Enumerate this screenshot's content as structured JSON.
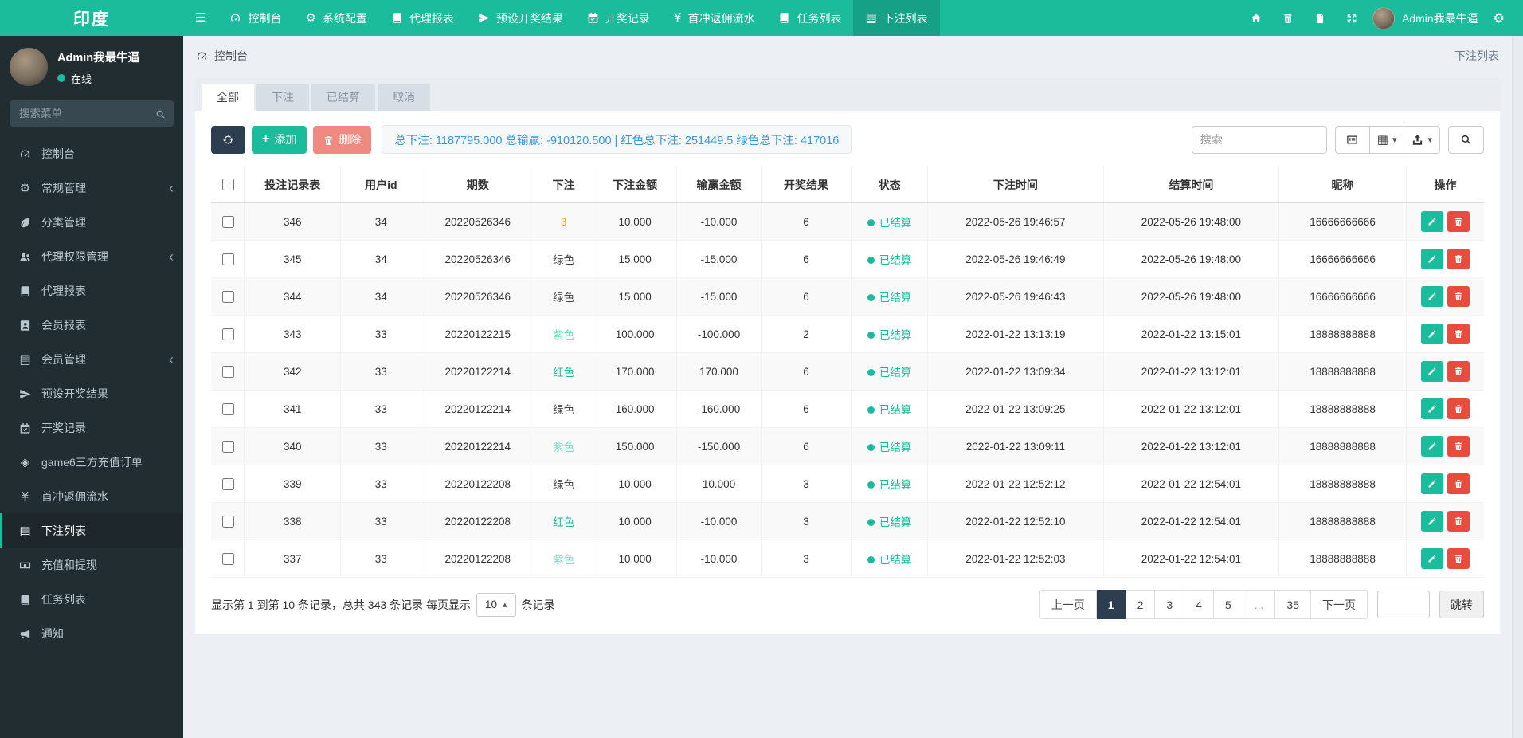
{
  "colors": {
    "navbar_teal": "#1abc9c",
    "navbar_active": "#16a085",
    "sidebar_dark": "#222d32",
    "navy": "#2c3e50",
    "add_green": "#1abc9c",
    "delete_salmon": "#ef8a80",
    "danger_red": "#e74c3c",
    "summary_blue": "#3498db",
    "status_green": "#18bc9c",
    "page_bg": "#ecf0f5"
  },
  "icon_glyphs": {
    "hamburger": "☰",
    "gear": "⚙",
    "gears": "⚙",
    "yen": "¥",
    "gem": "◈",
    "list": "▤",
    "grid": "▦",
    "caret-down": "▾",
    "caret-up": "▴",
    "chevron-left": "‹"
  },
  "navbar": {
    "brand": "印度",
    "items": [
      {
        "name": "sidebar-toggle",
        "icon": "hamburger",
        "label": ""
      },
      {
        "name": "dashboard",
        "icon": "speedo",
        "label": "控制台"
      },
      {
        "name": "system-config",
        "icon": "gear",
        "label": "系统配置"
      },
      {
        "name": "agent-report",
        "icon": "book",
        "label": "代理报表"
      },
      {
        "name": "preset-results",
        "icon": "send",
        "label": "预设开奖结果"
      },
      {
        "name": "draw-records",
        "icon": "calendar",
        "label": "开奖记录"
      },
      {
        "name": "first-charge-rebate",
        "icon": "yen",
        "label": "首冲返佣流水"
      },
      {
        "name": "task-list",
        "icon": "book",
        "label": "任务列表"
      },
      {
        "name": "bet-list",
        "icon": "list",
        "label": "下注列表",
        "active": true
      }
    ],
    "right_icons": [
      {
        "name": "home",
        "icon": "home"
      },
      {
        "name": "clear-trash",
        "icon": "trash"
      },
      {
        "name": "clear-cache",
        "icon": "doc"
      },
      {
        "name": "fullscreen",
        "icon": "expand"
      }
    ],
    "user": {
      "name": "Admin我最牛逼"
    }
  },
  "sidebar": {
    "user": {
      "name": "Admin我最牛逼",
      "status": "在线"
    },
    "search_placeholder": "搜索菜单",
    "items": [
      {
        "name": "dashboard",
        "icon": "speedo",
        "label": "控制台"
      },
      {
        "name": "general-management",
        "icon": "gears",
        "label": "常规管理",
        "arrow": true
      },
      {
        "name": "category-management",
        "icon": "leaf",
        "label": "分类管理"
      },
      {
        "name": "agent-permission",
        "icon": "users",
        "label": "代理权限管理",
        "arrow": true
      },
      {
        "name": "agent-report",
        "icon": "book",
        "label": "代理报表"
      },
      {
        "name": "member-report",
        "icon": "contact",
        "label": "会员报表"
      },
      {
        "name": "member-management",
        "icon": "list",
        "label": "会员管理",
        "arrow": true
      },
      {
        "name": "preset-results",
        "icon": "send",
        "label": "预设开奖结果"
      },
      {
        "name": "draw-records",
        "icon": "calendar",
        "label": "开奖记录"
      },
      {
        "name": "game6-recharge-orders",
        "icon": "gem",
        "label": "game6三方充值订单"
      },
      {
        "name": "first-charge-rebate",
        "icon": "yen",
        "label": "首冲返佣流水"
      },
      {
        "name": "bet-list",
        "icon": "list",
        "label": "下注列表",
        "active": true
      },
      {
        "name": "recharge-withdraw",
        "icon": "money",
        "label": "充值和提现"
      },
      {
        "name": "task-list",
        "icon": "book",
        "label": "任务列表"
      },
      {
        "name": "notification",
        "icon": "horn",
        "label": "通知"
      }
    ]
  },
  "breadcrumb": {
    "left": "控制台",
    "right": "下注列表"
  },
  "tabs": [
    {
      "name": "all",
      "label": "全部",
      "active": true
    },
    {
      "name": "bet",
      "label": "下注"
    },
    {
      "name": "settled",
      "label": "已结算"
    },
    {
      "name": "cancel",
      "label": "取消"
    }
  ],
  "toolbar": {
    "add_label": "添加",
    "delete_label": "删除",
    "summary": "总下注: 1187795.000 总输赢: -910120.500 | 红色总下注: 251449.5 绿色总下注: 417016",
    "search_placeholder": "搜索"
  },
  "table": {
    "headers": [
      "投注记录表",
      "用户id",
      "期数",
      "下注",
      "下注金额",
      "输赢金额",
      "开奖结果",
      "状态",
      "下注时间",
      "结算时间",
      "昵称",
      "操作"
    ],
    "rows": [
      {
        "record_id": "346",
        "user_id": "34",
        "period": "20220526346",
        "bet": "3",
        "bet_color": "#f39c12",
        "bet_amount": "10.000",
        "win_loss": "-10.000",
        "result": "6",
        "status": "已结算",
        "bet_time": "2022-05-26 19:46:57",
        "settle_time": "2022-05-26 19:48:00",
        "nickname": "16666666666"
      },
      {
        "record_id": "345",
        "user_id": "34",
        "period": "20220526346",
        "bet": "绿色",
        "bet_color": "#454545",
        "bet_amount": "15.000",
        "win_loss": "-15.000",
        "result": "6",
        "status": "已结算",
        "bet_time": "2022-05-26 19:46:49",
        "settle_time": "2022-05-26 19:48:00",
        "nickname": "16666666666"
      },
      {
        "record_id": "344",
        "user_id": "34",
        "period": "20220526346",
        "bet": "绿色",
        "bet_color": "#454545",
        "bet_amount": "15.000",
        "win_loss": "-15.000",
        "result": "6",
        "status": "已结算",
        "bet_time": "2022-05-26 19:46:43",
        "settle_time": "2022-05-26 19:48:00",
        "nickname": "16666666666"
      },
      {
        "record_id": "343",
        "user_id": "33",
        "period": "20220122215",
        "bet": "紫色",
        "bet_color": "#79dcc4",
        "bet_amount": "100.000",
        "win_loss": "-100.000",
        "result": "2",
        "status": "已结算",
        "bet_time": "2022-01-22 13:13:19",
        "settle_time": "2022-01-22 13:15:01",
        "nickname": "18888888888"
      },
      {
        "record_id": "342",
        "user_id": "33",
        "period": "20220122214",
        "bet": "红色",
        "bet_color": "#18bc9c",
        "bet_amount": "170.000",
        "win_loss": "170.000",
        "result": "6",
        "status": "已结算",
        "bet_time": "2022-01-22 13:09:34",
        "settle_time": "2022-01-22 13:12:01",
        "nickname": "18888888888"
      },
      {
        "record_id": "341",
        "user_id": "33",
        "period": "20220122214",
        "bet": "绿色",
        "bet_color": "#454545",
        "bet_amount": "160.000",
        "win_loss": "-160.000",
        "result": "6",
        "status": "已结算",
        "bet_time": "2022-01-22 13:09:25",
        "settle_time": "2022-01-22 13:12:01",
        "nickname": "18888888888"
      },
      {
        "record_id": "340",
        "user_id": "33",
        "period": "20220122214",
        "bet": "紫色",
        "bet_color": "#79dcc4",
        "bet_amount": "150.000",
        "win_loss": "-150.000",
        "result": "6",
        "status": "已结算",
        "bet_time": "2022-01-22 13:09:11",
        "settle_time": "2022-01-22 13:12:01",
        "nickname": "18888888888"
      },
      {
        "record_id": "339",
        "user_id": "33",
        "period": "20220122208",
        "bet": "绿色",
        "bet_color": "#454545",
        "bet_amount": "10.000",
        "win_loss": "10.000",
        "result": "3",
        "status": "已结算",
        "bet_time": "2022-01-22 12:52:12",
        "settle_time": "2022-01-22 12:54:01",
        "nickname": "18888888888"
      },
      {
        "record_id": "338",
        "user_id": "33",
        "period": "20220122208",
        "bet": "红色",
        "bet_color": "#18bc9c",
        "bet_amount": "10.000",
        "win_loss": "-10.000",
        "result": "3",
        "status": "已结算",
        "bet_time": "2022-01-22 12:52:10",
        "settle_time": "2022-01-22 12:54:01",
        "nickname": "18888888888"
      },
      {
        "record_id": "337",
        "user_id": "33",
        "period": "20220122208",
        "bet": "紫色",
        "bet_color": "#79dcc4",
        "bet_amount": "10.000",
        "win_loss": "-10.000",
        "result": "3",
        "status": "已结算",
        "bet_time": "2022-01-22 12:52:03",
        "settle_time": "2022-01-22 12:54:01",
        "nickname": "18888888888"
      }
    ]
  },
  "footer": {
    "showing": "显示第 1 到第 10 条记录，总共 343 条记录 每页显示",
    "page_size": "10",
    "suffix": "条记录"
  },
  "pagination": {
    "items": [
      "上一页",
      "1",
      "2",
      "3",
      "4",
      "5",
      "...",
      "35",
      "下一页"
    ],
    "active": "1",
    "jump_label": "跳转"
  }
}
